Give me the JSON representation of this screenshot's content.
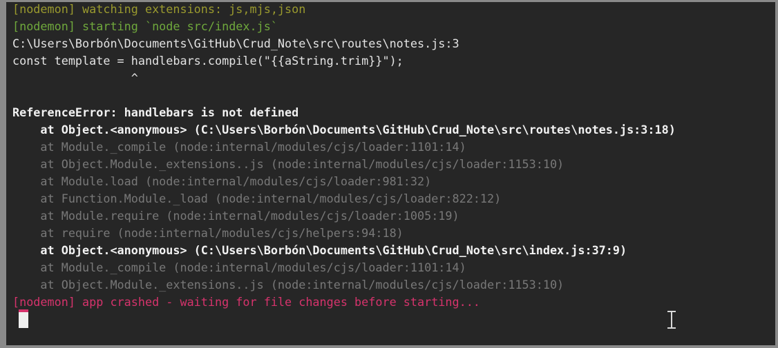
{
  "terminal": {
    "app_name": "nodemon-node-terminal",
    "colors": {
      "background": "#262626",
      "border": "#8a8a8a",
      "nodemon_watching": "#9a9a2e",
      "nodemon_starting": "#6fa83c",
      "normal_text": "#e3e3e3",
      "bold_text": "#f2f2f2",
      "dim_text": "#787878",
      "crash_text": "#d6336c",
      "cursor": "#efefef"
    },
    "cursor": {
      "block_cursor_visible": true,
      "mouse_pointer": "i-beam-cursor"
    },
    "lines": [
      {
        "text": "[nodemon] watching extensions: js,mjs,json",
        "style": "c-yellow"
      },
      {
        "text": "[nodemon] starting `node src/index.js`",
        "style": "c-green"
      },
      {
        "text": "C:\\Users\\Borbón\\Documents\\GitHub\\Crud_Note\\src\\routes\\notes.js:3",
        "style": "c-white"
      },
      {
        "text": "const template = handlebars.compile(\"{{aString.trim}}\");",
        "style": "c-white"
      },
      {
        "text": "                 ^",
        "style": "c-white"
      },
      {
        "text": "",
        "style": "c-blank"
      },
      {
        "text": "ReferenceError: handlebars is not defined",
        "style": "c-bold"
      },
      {
        "text": "    at Object.<anonymous> (C:\\Users\\Borbón\\Documents\\GitHub\\Crud_Note\\src\\routes\\notes.js:3:18)",
        "style": "c-bold"
      },
      {
        "text": "    at Module._compile (node:internal/modules/cjs/loader:1101:14)",
        "style": "c-dim"
      },
      {
        "text": "    at Object.Module._extensions..js (node:internal/modules/cjs/loader:1153:10)",
        "style": "c-dim"
      },
      {
        "text": "    at Module.load (node:internal/modules/cjs/loader:981:32)",
        "style": "c-dim"
      },
      {
        "text": "    at Function.Module._load (node:internal/modules/cjs/loader:822:12)",
        "style": "c-dim"
      },
      {
        "text": "    at Module.require (node:internal/modules/cjs/loader:1005:19)",
        "style": "c-dim"
      },
      {
        "text": "    at require (node:internal/modules/cjs/helpers:94:18)",
        "style": "c-dim"
      },
      {
        "text": "    at Object.<anonymous> (C:\\Users\\Borbón\\Documents\\GitHub\\Crud_Note\\src\\index.js:37:9)",
        "style": "c-bold"
      },
      {
        "text": "    at Module._compile (node:internal/modules/cjs/loader:1101:14)",
        "style": "c-dim"
      },
      {
        "text": "    at Object.Module._extensions..js (node:internal/modules/cjs/loader:1153:10)",
        "style": "c-dim"
      },
      {
        "text": "[nodemon] app crashed - waiting for file changes before starting...",
        "style": "c-crimson"
      }
    ]
  }
}
